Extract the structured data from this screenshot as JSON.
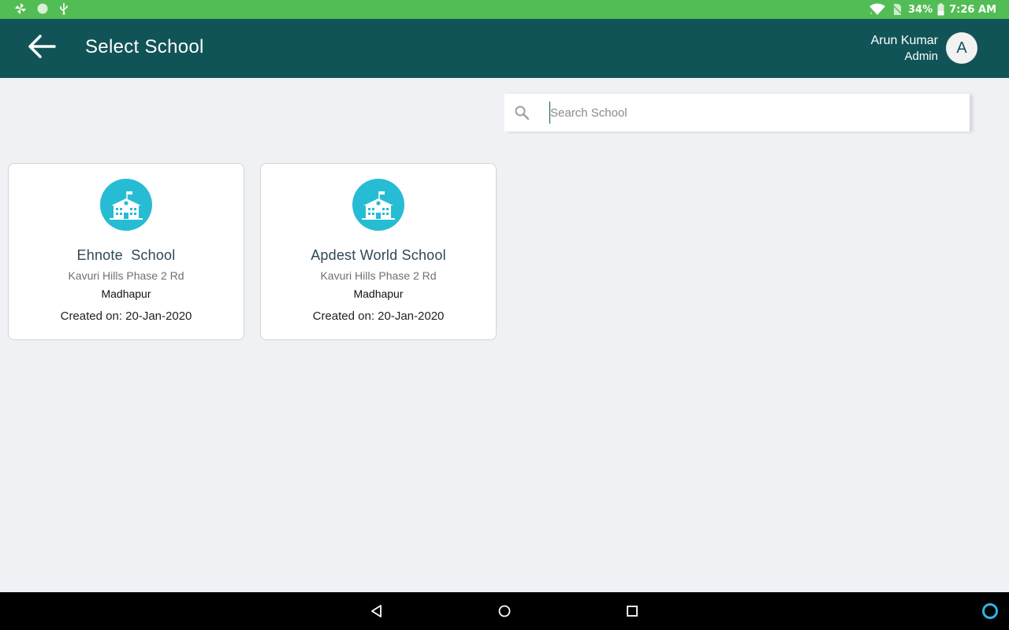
{
  "status_bar": {
    "battery": "34%",
    "time": "7:26 AM",
    "icons": [
      "pinwheel-icon",
      "circle-icon",
      "usb-icon",
      "wifi-icon",
      "no-sim-icon",
      "battery-icon"
    ]
  },
  "header": {
    "title": "Select School",
    "user_name": "Arun Kumar",
    "user_role": "Admin",
    "avatar_initial": "A",
    "background": "#115458"
  },
  "search": {
    "placeholder": "Search School",
    "value": ""
  },
  "schools": [
    {
      "name": "Ehnote  School",
      "address": "Kavuri Hills Phase 2 Rd",
      "city": "Madhapur",
      "created": "Created on: 20-Jan-2020"
    },
    {
      "name": "Apdest World School",
      "address": "Kavuri Hills Phase 2 Rd",
      "city": "Madhapur",
      "created": "Created on: 20-Jan-2020"
    }
  ],
  "colors": {
    "status_bar": "#52bd55",
    "accent_icon": "#26bcd4",
    "background": "#f0f1f5"
  }
}
